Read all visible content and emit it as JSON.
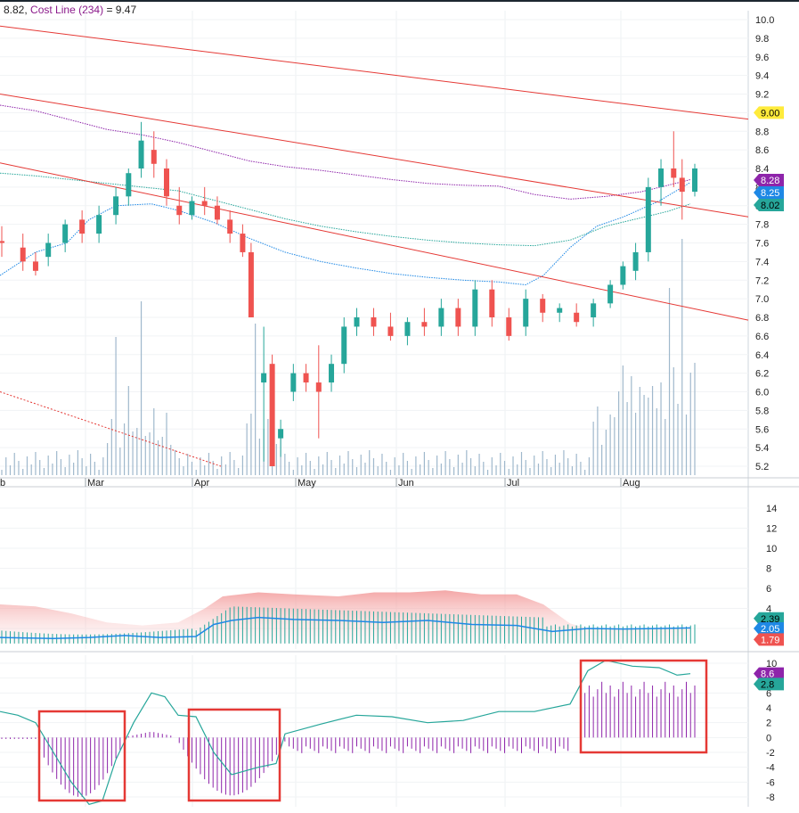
{
  "header": {
    "value_prefix": "8.82,",
    "cost_line_label": "Cost Line (234)",
    "cost_line_eq": "= 9.47"
  },
  "colors": {
    "up": "#26a69a",
    "down": "#ef5350",
    "trendline": "#e53935",
    "purple_ma": "#8e24aa",
    "teal_ma": "#26a69a",
    "blue_ma": "#1e88e5",
    "volume": "#9fb8cc",
    "highlight_box": "#e53935"
  },
  "chart_data": [
    {
      "type": "candlestick",
      "name": "price",
      "x_tick_labels": [
        "Feb",
        "Mar",
        "Apr",
        "May",
        "Jun",
        "Jul",
        "Aug"
      ],
      "y_ticks": [
        5.2,
        5.4,
        5.6,
        5.8,
        6.0,
        6.2,
        6.4,
        6.6,
        6.8,
        7.0,
        7.2,
        7.4,
        7.6,
        7.8,
        8.0,
        8.2,
        8.4,
        8.6,
        8.8,
        9.0,
        9.2,
        9.4,
        9.6,
        9.8,
        10.0
      ],
      "ylim": [
        5.05,
        10.15
      ],
      "n_bars": 165,
      "candles": [
        {
          "i": 0,
          "o": 7.62,
          "h": 7.78,
          "l": 7.45,
          "c": 7.6
        },
        {
          "i": 5,
          "o": 7.55,
          "h": 7.7,
          "l": 7.3,
          "c": 7.4
        },
        {
          "i": 8,
          "o": 7.4,
          "h": 7.5,
          "l": 7.25,
          "c": 7.3
        },
        {
          "i": 11,
          "o": 7.45,
          "h": 7.7,
          "l": 7.35,
          "c": 7.6
        },
        {
          "i": 15,
          "o": 7.6,
          "h": 7.85,
          "l": 7.5,
          "c": 7.8
        },
        {
          "i": 19,
          "o": 7.85,
          "h": 7.95,
          "l": 7.6,
          "c": 7.7
        },
        {
          "i": 23,
          "o": 7.7,
          "h": 8.0,
          "l": 7.6,
          "c": 7.9
        },
        {
          "i": 27,
          "o": 7.9,
          "h": 8.2,
          "l": 7.8,
          "c": 8.1
        },
        {
          "i": 30,
          "o": 8.1,
          "h": 8.4,
          "l": 8.0,
          "c": 8.35
        },
        {
          "i": 33,
          "o": 8.4,
          "h": 8.9,
          "l": 8.3,
          "c": 8.7
        },
        {
          "i": 36,
          "o": 8.6,
          "h": 8.8,
          "l": 8.3,
          "c": 8.45
        },
        {
          "i": 39,
          "o": 8.4,
          "h": 8.5,
          "l": 8.0,
          "c": 8.1
        },
        {
          "i": 42,
          "o": 8.0,
          "h": 8.2,
          "l": 7.8,
          "c": 7.9
        },
        {
          "i": 45,
          "o": 7.9,
          "h": 8.1,
          "l": 7.85,
          "c": 8.05
        },
        {
          "i": 48,
          "o": 8.05,
          "h": 8.2,
          "l": 7.9,
          "c": 8.0
        },
        {
          "i": 51,
          "o": 8.0,
          "h": 8.1,
          "l": 7.8,
          "c": 7.85
        },
        {
          "i": 54,
          "o": 7.85,
          "h": 7.95,
          "l": 7.6,
          "c": 7.7
        },
        {
          "i": 57,
          "o": 7.7,
          "h": 7.8,
          "l": 7.45,
          "c": 7.5
        },
        {
          "i": 59,
          "o": 7.5,
          "h": 7.6,
          "l": 6.8,
          "c": 6.8
        },
        {
          "i": 62,
          "o": 6.1,
          "h": 6.7,
          "l": 5.25,
          "c": 6.2
        },
        {
          "i": 64,
          "o": 6.3,
          "h": 6.4,
          "l": 5.2,
          "c": 5.2
        },
        {
          "i": 66,
          "o": 5.5,
          "h": 5.7,
          "l": 5.3,
          "c": 5.6
        },
        {
          "i": 69,
          "o": 6.0,
          "h": 6.3,
          "l": 5.9,
          "c": 6.2
        },
        {
          "i": 72,
          "o": 6.2,
          "h": 6.3,
          "l": 6.0,
          "c": 6.1
        },
        {
          "i": 75,
          "o": 6.1,
          "h": 6.5,
          "l": 5.5,
          "c": 6.0
        },
        {
          "i": 78,
          "o": 6.1,
          "h": 6.4,
          "l": 6.0,
          "c": 6.3
        },
        {
          "i": 81,
          "o": 6.3,
          "h": 6.8,
          "l": 6.2,
          "c": 6.7
        },
        {
          "i": 84,
          "o": 6.7,
          "h": 6.9,
          "l": 6.6,
          "c": 6.8
        },
        {
          "i": 88,
          "o": 6.8,
          "h": 6.9,
          "l": 6.6,
          "c": 6.7
        },
        {
          "i": 92,
          "o": 6.7,
          "h": 6.85,
          "l": 6.55,
          "c": 6.6
        },
        {
          "i": 96,
          "o": 6.6,
          "h": 6.8,
          "l": 6.5,
          "c": 6.75
        },
        {
          "i": 100,
          "o": 6.75,
          "h": 6.9,
          "l": 6.6,
          "c": 6.7
        },
        {
          "i": 104,
          "o": 6.7,
          "h": 7.0,
          "l": 6.6,
          "c": 6.9
        },
        {
          "i": 108,
          "o": 6.9,
          "h": 7.0,
          "l": 6.6,
          "c": 6.7
        },
        {
          "i": 112,
          "o": 6.7,
          "h": 7.2,
          "l": 6.6,
          "c": 7.1
        },
        {
          "i": 116,
          "o": 7.1,
          "h": 7.2,
          "l": 6.7,
          "c": 6.8
        },
        {
          "i": 120,
          "o": 6.8,
          "h": 6.9,
          "l": 6.55,
          "c": 6.6
        },
        {
          "i": 124,
          "o": 6.7,
          "h": 7.1,
          "l": 6.6,
          "c": 7.0
        },
        {
          "i": 128,
          "o": 7.0,
          "h": 7.05,
          "l": 6.75,
          "c": 6.85
        },
        {
          "i": 132,
          "o": 6.85,
          "h": 6.95,
          "l": 6.75,
          "c": 6.9
        },
        {
          "i": 136,
          "o": 6.85,
          "h": 6.95,
          "l": 6.7,
          "c": 6.75
        },
        {
          "i": 140,
          "o": 6.8,
          "h": 7.0,
          "l": 6.7,
          "c": 6.95
        }
      ],
      "candles_late": [
        {
          "i": 144,
          "o": 6.95,
          "h": 7.2,
          "l": 6.9,
          "c": 7.15
        },
        {
          "i": 147,
          "o": 7.15,
          "h": 7.4,
          "l": 7.1,
          "c": 7.35
        },
        {
          "i": 150,
          "o": 7.3,
          "h": 7.6,
          "l": 7.2,
          "c": 7.5
        },
        {
          "i": 153,
          "o": 7.5,
          "h": 8.3,
          "l": 7.4,
          "c": 8.2
        },
        {
          "i": 156,
          "o": 8.2,
          "h": 8.5,
          "l": 8.0,
          "c": 8.4
        },
        {
          "i": 159,
          "o": 8.4,
          "h": 8.8,
          "l": 8.2,
          "c": 8.3
        }
      ],
      "note_scale": "price series continues into Jul-Aug rally"
    }
  ]
}
